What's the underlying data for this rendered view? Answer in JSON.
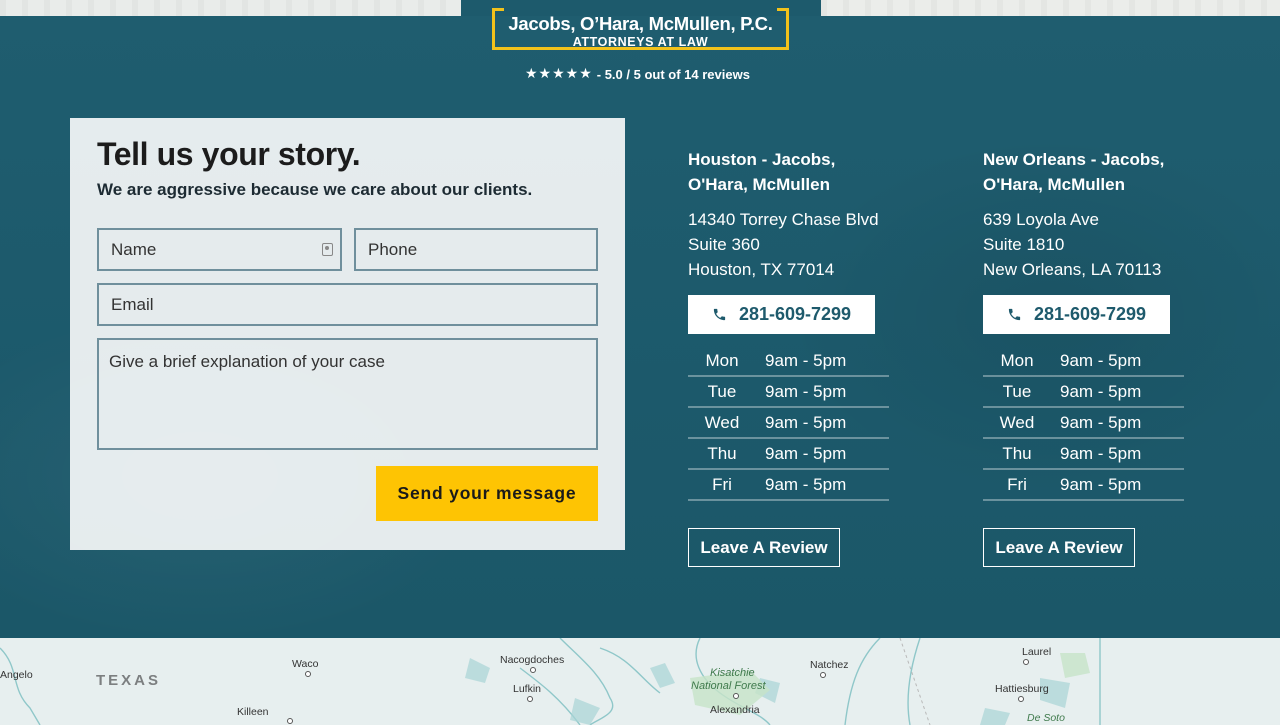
{
  "header": {
    "firm_name": "Jacobs, O’Hara, McMullen, P.C.",
    "firm_tagline": "ATTORNEYS AT LAW",
    "stars": "★★★★★",
    "rating_text": "- 5.0 / 5 out of 14 reviews"
  },
  "form": {
    "title": "Tell us your story.",
    "subtitle": "We are aggressive because we care about our clients.",
    "name_placeholder": "Name",
    "phone_placeholder": "Phone",
    "email_placeholder": "Email",
    "message_placeholder": "Give a brief explanation of your case",
    "submit_label": "Send your message"
  },
  "offices": [
    {
      "title_line1": "Houston - Jacobs,",
      "title_line2": "O'Hara, McMullen",
      "address_line1": "14340 Torrey Chase Blvd",
      "address_line2": "Suite 360",
      "address_line3": "Houston, TX 77014",
      "phone": "281-609-7299",
      "hours": [
        {
          "day": "Mon",
          "time": "9am - 5pm"
        },
        {
          "day": "Tue",
          "time": "9am - 5pm"
        },
        {
          "day": "Wed",
          "time": "9am - 5pm"
        },
        {
          "day": "Thu",
          "time": "9am - 5pm"
        },
        {
          "day": "Fri",
          "time": "9am - 5pm"
        }
      ],
      "review_label": "Leave A Review"
    },
    {
      "title_line1": "New Orleans - Jacobs,",
      "title_line2": "O'Hara, McMullen",
      "address_line1": "639 Loyola Ave",
      "address_line2": "Suite 1810",
      "address_line3": "New Orleans, LA 70113",
      "phone": "281-609-7299",
      "hours": [
        {
          "day": "Mon",
          "time": "9am - 5pm"
        },
        {
          "day": "Tue",
          "time": "9am - 5pm"
        },
        {
          "day": "Wed",
          "time": "9am - 5pm"
        },
        {
          "day": "Thu",
          "time": "9am - 5pm"
        },
        {
          "day": "Fri",
          "time": "9am - 5pm"
        }
      ],
      "review_label": "Leave A Review"
    }
  ],
  "map": {
    "labels": {
      "angelo": "Angelo",
      "texas": "TEXAS",
      "waco": "Waco",
      "killeen": "Killeen",
      "nacogdoches": "Nacogdoches",
      "lufkin": "Lufkin",
      "kisatchie_1": "Kisatchie",
      "kisatchie_2": "National Forest",
      "alexandria": "Alexandria",
      "natchez": "Natchez",
      "laurel": "Laurel",
      "hattiesburg": "Hattiesburg",
      "desoto": "De Soto"
    }
  },
  "colors": {
    "background": "#1d5a6c",
    "accent": "#fec403",
    "logo_border": "#f2c21b"
  }
}
